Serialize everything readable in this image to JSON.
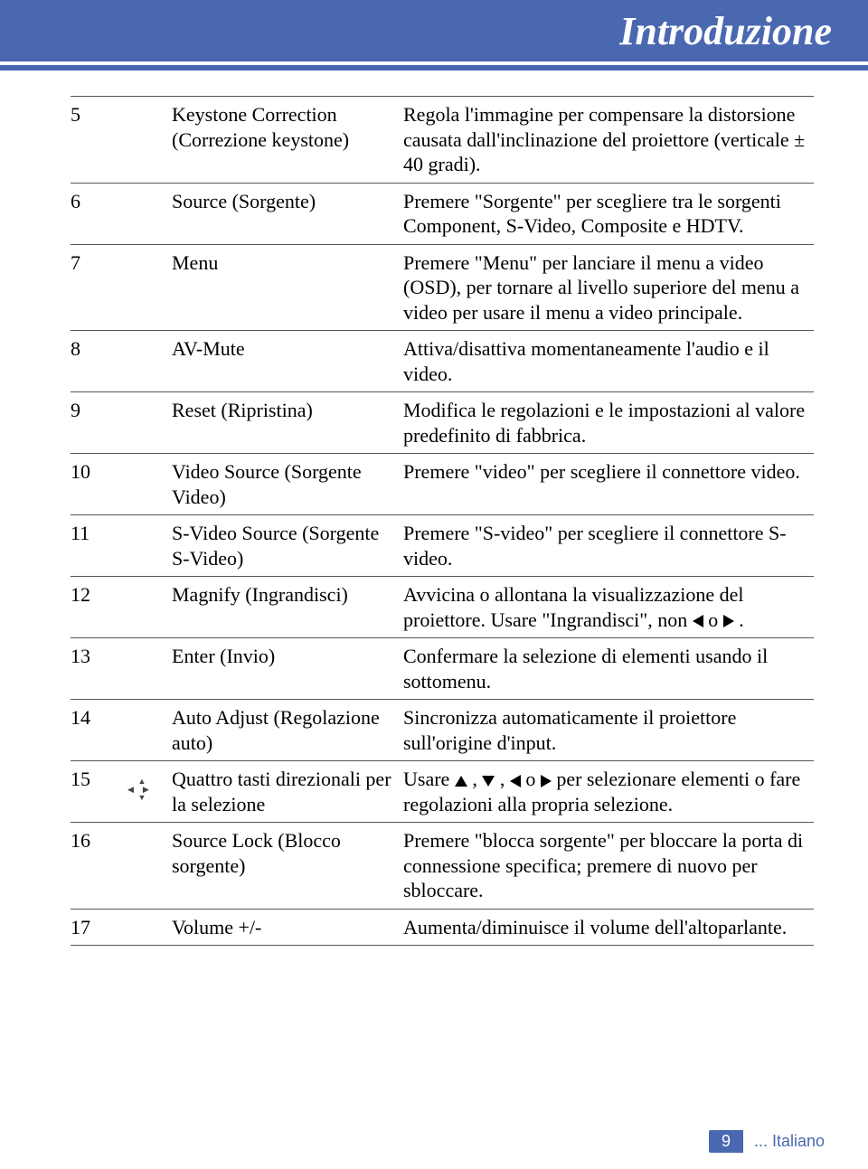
{
  "header": {
    "title": "Introduzione"
  },
  "rows": [
    {
      "num": "5",
      "name": "Keystone Correction (Correzione keystone)",
      "desc": "Regola l'immagine per compensare la distorsione causata dall'inclinazione del proiettore (verticale ± 40 gradi)."
    },
    {
      "num": "6",
      "name": "Source (Sorgente)",
      "desc": "Premere \"Sorgente\" per scegliere tra le sorgenti Component, S-Video, Composite e HDTV."
    },
    {
      "num": "7",
      "name": "Menu",
      "desc": "Premere \"Menu\" per lanciare il menu a video (OSD), per tornare al livello superiore del menu a video per usare il menu a video principale."
    },
    {
      "num": "8",
      "name": "AV-Mute",
      "desc": "Attiva/disattiva momentaneamente l'audio e il video."
    },
    {
      "num": "9",
      "name": "Reset (Ripristina)",
      "desc": "Modifica le regolazioni e le impostazioni al valore predefinito di fabbrica."
    },
    {
      "num": "10",
      "name": "Video Source (Sorgente Video)",
      "desc": "Premere \"video\" per scegliere il connettore video."
    },
    {
      "num": "11",
      "name": "S-Video Source (Sorgente S-Video)",
      "desc": "Premere \"S-video\" per scegliere il connettore S-video."
    },
    {
      "num": "12",
      "name": "Magnify (Ingrandisci)",
      "desc_pre": "Avvicina o allontana la visualizzazione del proiettore. Usare \"Ingrandisci\", non ",
      "desc_mid": " o ",
      "desc_post": " ."
    },
    {
      "num": "13",
      "name": "Enter (Invio)",
      "desc": "Confermare la selezione di elementi usando il sottomenu."
    },
    {
      "num": "14",
      "name": "Auto Adjust (Regolazione auto)",
      "desc": "Sincronizza automaticamente il proiettore sull'origine d'input."
    },
    {
      "num": "15",
      "name": "Quattro tasti direzionali per la selezione",
      "desc_pre": "Usare ",
      "desc_j1": " , ",
      "desc_j2": " , ",
      "desc_j3": " o ",
      "desc_post": " per selezionare elementi o fare regolazioni alla propria selezione."
    },
    {
      "num": "16",
      "name": "Source Lock (Blocco sorgente)",
      "desc": "Premere \"blocca sorgente\" per bloccare la porta di connessione specifica; premere di nuovo per sbloccare."
    },
    {
      "num": "17",
      "name": "Volume +/-",
      "desc": "Aumenta/diminuisce il volume dell'altoparlante."
    }
  ],
  "footer": {
    "page": "9",
    "language": "... Italiano"
  }
}
